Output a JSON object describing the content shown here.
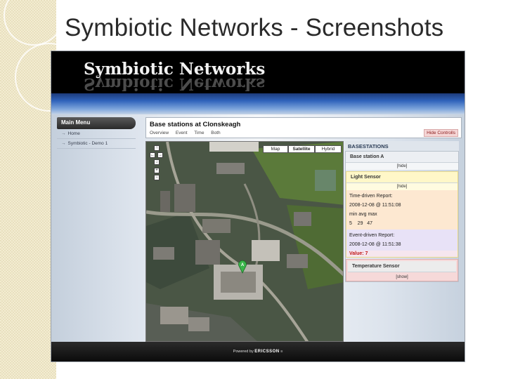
{
  "slide": {
    "title": "Symbiotic Networks - Screenshots"
  },
  "app": {
    "banner_title": "Symbiotic Networks",
    "footer_powered": "Powered by",
    "footer_brand": "ERICSSON"
  },
  "menu": {
    "header": "Main Menu",
    "items": [
      {
        "label": "Home"
      },
      {
        "label": "Symbiotic - Demo 1"
      }
    ]
  },
  "panel": {
    "title": "Base stations at Clonskeagh",
    "tabs": [
      "Overview",
      "Event",
      "Time",
      "Both"
    ],
    "hide_controls": "Hide Controlls"
  },
  "map": {
    "types": [
      "Map",
      "Satellite",
      "Hybrid"
    ],
    "selected_type": "Satellite",
    "marker_label": "A",
    "nav_icons": [
      "pan-up-icon",
      "pan-left-icon",
      "pan-right-icon",
      "pan-down-icon",
      "zoom-in-icon",
      "zoom-out-icon"
    ]
  },
  "basestations": {
    "header": "BASESTATIONS",
    "station": {
      "name": "Base station A",
      "toggle": "[hide]"
    },
    "light_sensor": {
      "name": "Light Sensor",
      "toggle": "[hide]",
      "time_report_label": "Time-driven Report:",
      "time_report_time": "2008-12-08 @ 11:51:08",
      "stats_header": "min avg max",
      "stats_values": "5    29   47",
      "event_report_label": "Event-driven Report:",
      "event_report_time": "2008-12-08 @ 11:51:38",
      "value": "Value: 7"
    },
    "temperature_sensor": {
      "name": "Temperature Sensor",
      "toggle": "[show]"
    }
  },
  "colors": {
    "banner_bg": "#000000",
    "bluebar": "#2f63bb",
    "value_red": "#c01818",
    "light_sensor_bg": "#fffbe0",
    "time_report_bg": "#fde8d1",
    "event_report_bg": "#e8e2f7",
    "temp_sensor_bg": "#f6d9d9"
  }
}
